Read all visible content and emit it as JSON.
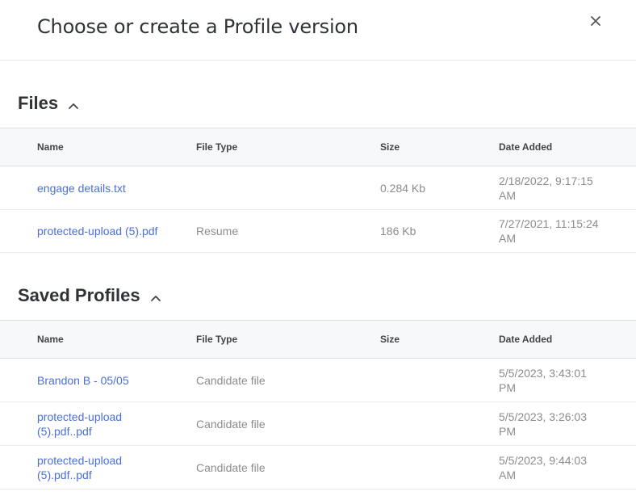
{
  "modal": {
    "title": "Choose or create a Profile version"
  },
  "columns": {
    "name": "Name",
    "file_type": "File Type",
    "size": "Size",
    "date_added": "Date Added"
  },
  "files": {
    "title": "Files",
    "rows": [
      {
        "name": "engage details.txt",
        "file_type": "",
        "size": "0.284 Kb",
        "date": "2/18/2022, 9:17:15 AM"
      },
      {
        "name": "protected-upload (5).pdf",
        "file_type": "Resume",
        "size": "186 Kb",
        "date": "7/27/2021, 11:15:24 AM"
      }
    ]
  },
  "saved_profiles": {
    "title": "Saved Profiles",
    "rows": [
      {
        "name": "Brandon B - 05/05",
        "file_type": "Candidate file",
        "size": "",
        "date": "5/5/2023, 3:43:01 PM"
      },
      {
        "name": "protected-upload (5).pdf..pdf",
        "file_type": "Candidate file",
        "size": "",
        "date": "5/5/2023, 3:26:03 PM"
      },
      {
        "name": "protected-upload (5).pdf..pdf",
        "file_type": "Candidate file",
        "size": "",
        "date": "5/5/2023, 9:44:03 AM"
      }
    ]
  },
  "icons": {
    "close": "close-icon",
    "collapse": "chevron-up-icon"
  }
}
